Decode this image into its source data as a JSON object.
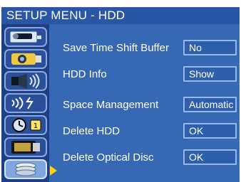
{
  "header": {
    "title": "SETUP MENU - HDD"
  },
  "sidebar": {
    "items": [
      {
        "icon": "video-camera-icon",
        "active": false
      },
      {
        "icon": "camera-icon",
        "active": false
      },
      {
        "icon": "speaker-icon",
        "active": false
      },
      {
        "icon": "signal-icon",
        "active": false
      },
      {
        "icon": "timer-icon",
        "active": false
      },
      {
        "icon": "tv-icon",
        "active": false
      },
      {
        "icon": "hdd-icon",
        "active": true
      }
    ]
  },
  "rows": [
    {
      "label": "Save Time Shift Buffer",
      "value": "No"
    },
    {
      "label": "HDD Info",
      "value": "Show"
    },
    {
      "label": "Space Management",
      "value": "Automatic"
    },
    {
      "label": "Delete HDD",
      "value": "OK"
    },
    {
      "label": "Delete Optical Disc",
      "value": "OK"
    }
  ],
  "colors": {
    "background": "#3768b3",
    "title_bar": "#2a56a6",
    "sidebar": "#1e3f86",
    "selection_arrow": "#ffd200",
    "text": "#ffffff"
  }
}
